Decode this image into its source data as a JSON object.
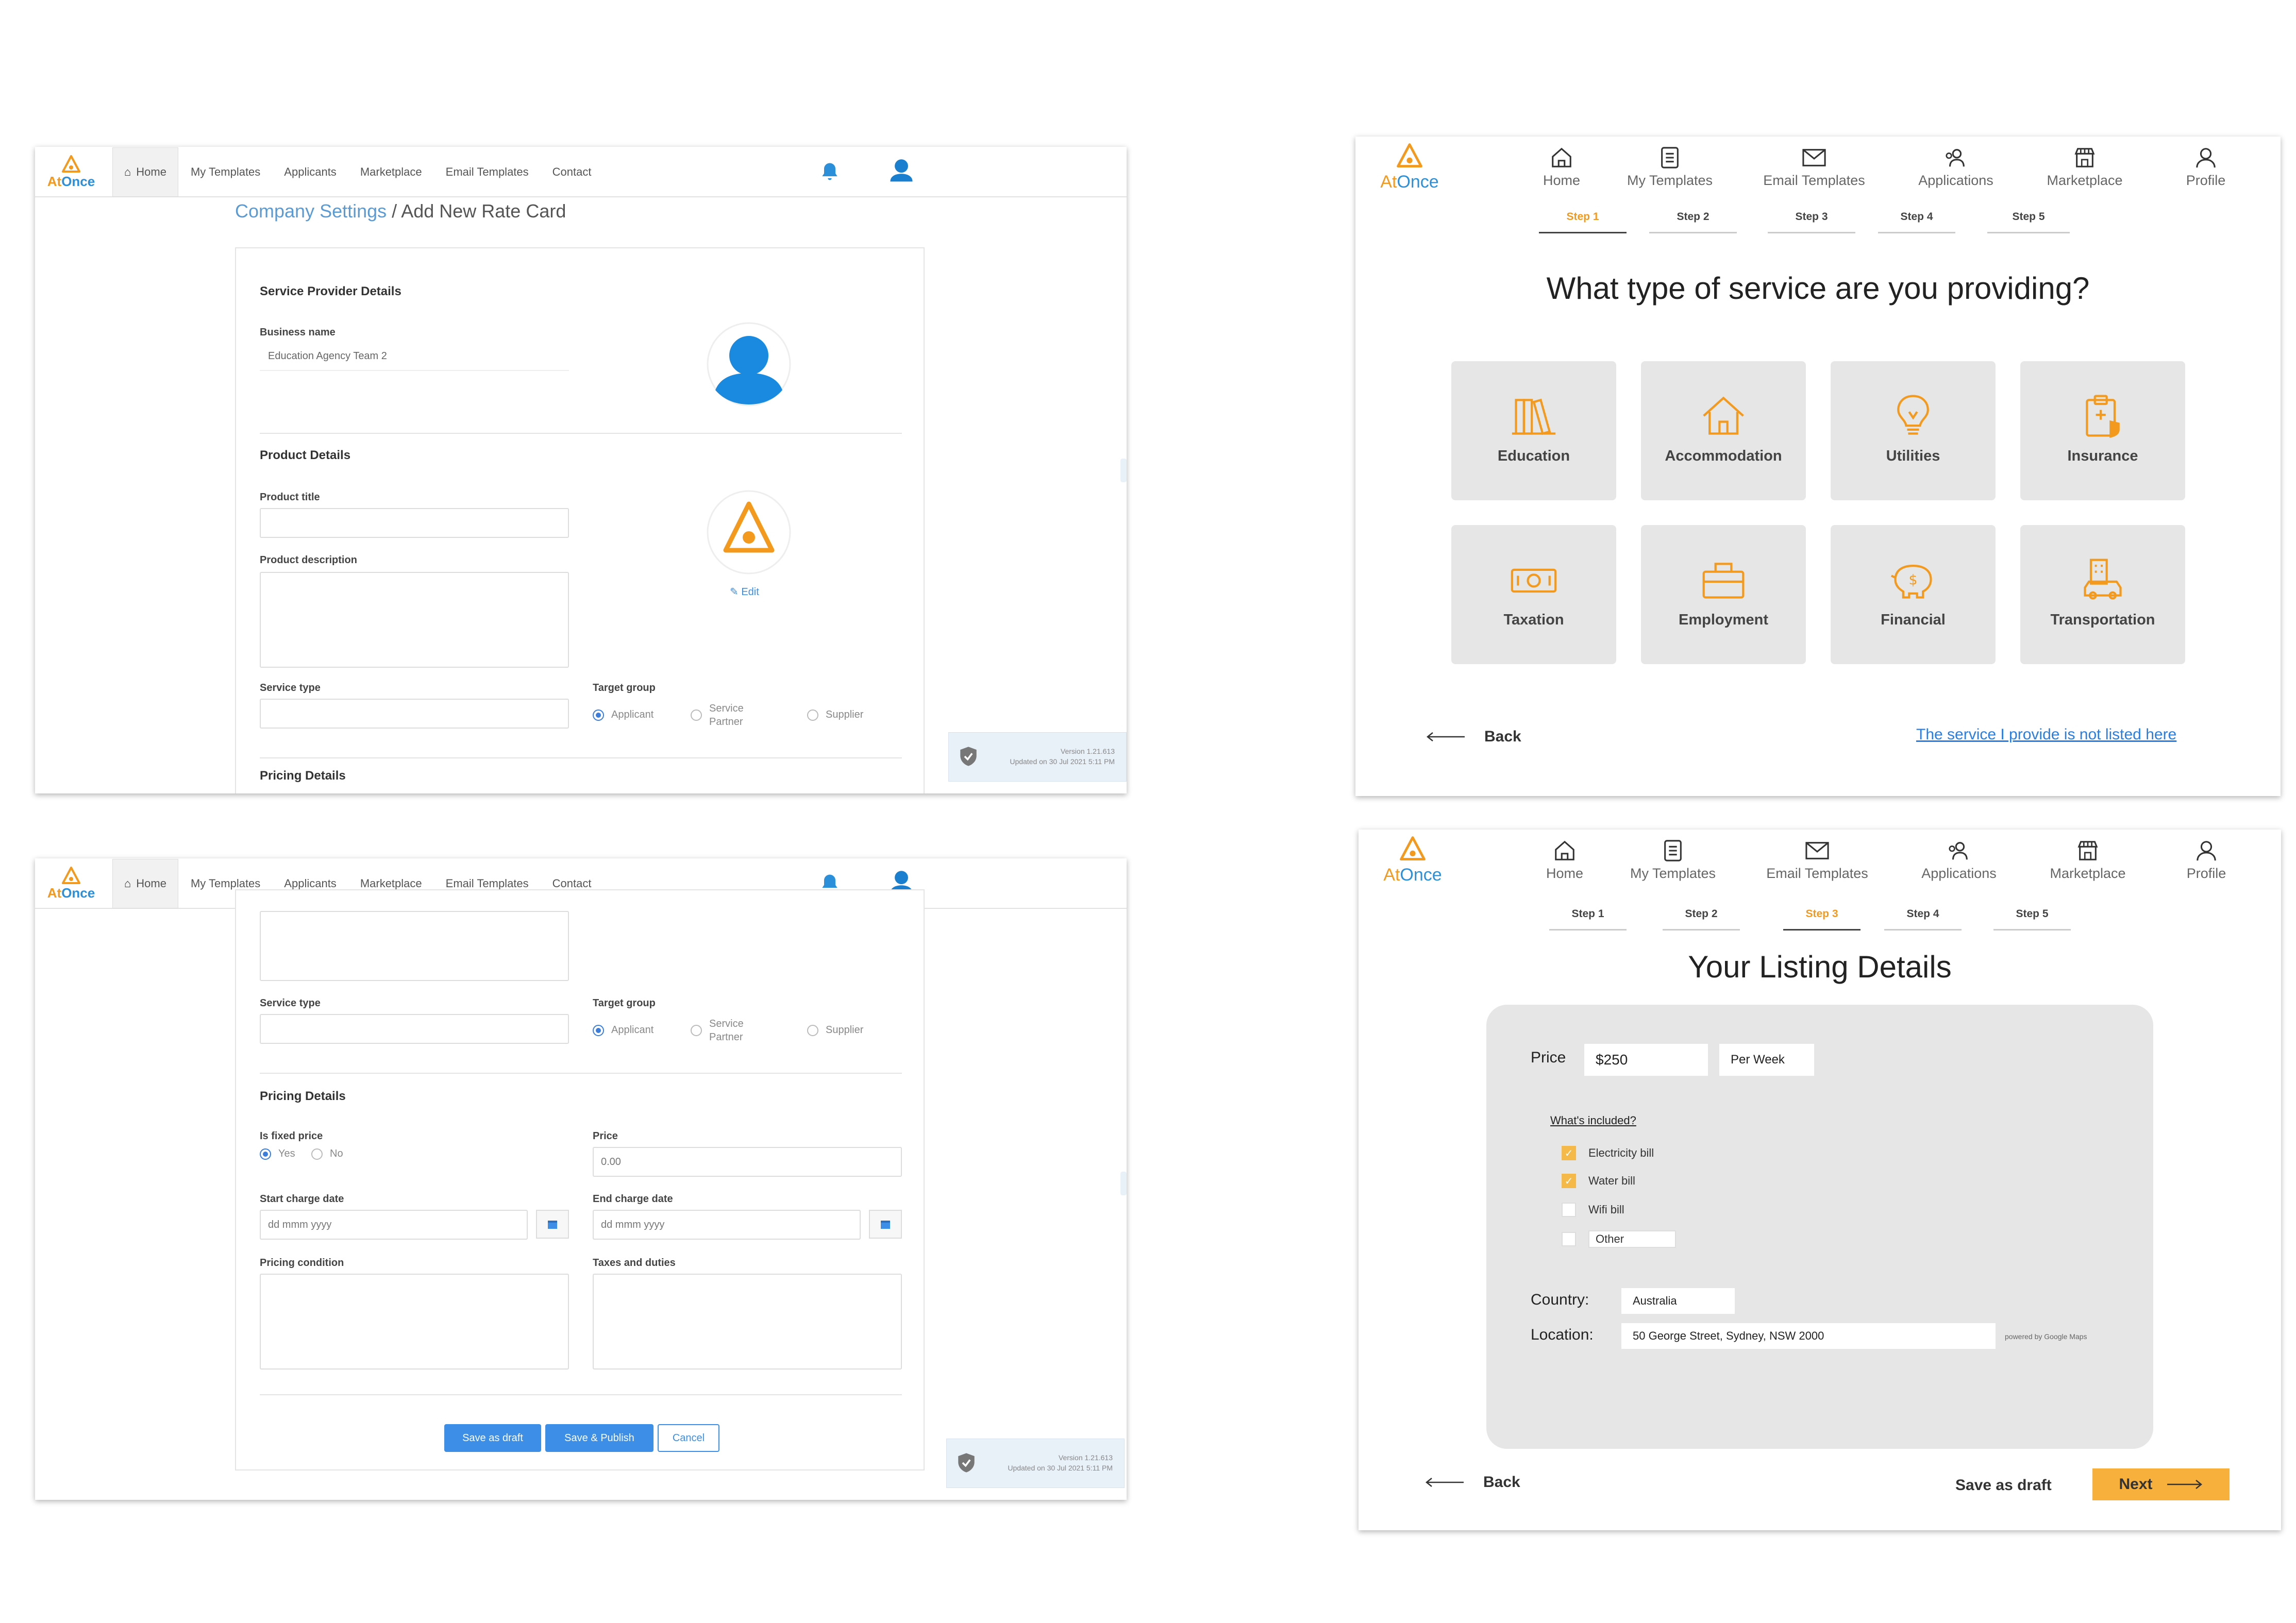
{
  "admin_nav": {
    "logo_prefix": "At",
    "logo_suffix": "Once",
    "items": [
      "Home",
      "My Templates",
      "Applicants",
      "Marketplace",
      "Email Templates",
      "Contact"
    ]
  },
  "screen1": {
    "breadcrumb_parent": "Company Settings",
    "breadcrumb_sep": "/",
    "breadcrumb_current": "Add New Rate Card",
    "service_provider_title": "Service Provider Details",
    "business_name_label": "Business name",
    "business_name_value": "Education Agency Team 2",
    "product_details_title": "Product Details",
    "product_title_label": "Product title",
    "product_description_label": "Product description",
    "edit_label": "Edit",
    "service_type_label": "Service type",
    "target_group_label": "Target group",
    "target_options": [
      "Applicant",
      "Service Partner",
      "Supplier"
    ],
    "pricing_details_title": "Pricing Details",
    "version_line1": "Version 1.21.613",
    "version_line2": "Updated on 30 Jul 2021 5:11 PM"
  },
  "screen2": {
    "service_type_label": "Service type",
    "target_group_label": "Target group",
    "target_options": [
      "Applicant",
      "Service Partner",
      "Supplier"
    ],
    "pricing_details_title": "Pricing Details",
    "is_fixed_price_label": "Is fixed price",
    "fixed_options": [
      "Yes",
      "No"
    ],
    "price_label": "Price",
    "price_value": "0.00",
    "start_date_label": "Start charge date",
    "start_date_placeholder": "dd mmm yyyy",
    "end_date_label": "End charge date",
    "end_date_placeholder": "dd mmm yyyy",
    "pricing_condition_label": "Pricing condition",
    "taxes_label": "Taxes and duties",
    "save_draft": "Save as draft",
    "save_publish": "Save & Publish",
    "cancel": "Cancel",
    "version_line1": "Version 1.21.613",
    "version_line2": "Updated on 30 Jul 2021 5:11 PM"
  },
  "new_nav": {
    "logo_prefix": "At",
    "logo_suffix": "Once",
    "items": [
      "Home",
      "My Templates",
      "Email Templates",
      "Applications",
      "Marketplace",
      "Profile"
    ],
    "icons": [
      "home-icon",
      "templates-icon",
      "email-icon",
      "applications-icon",
      "marketplace-icon",
      "profile-icon"
    ]
  },
  "steps": [
    "Step 1",
    "Step 2",
    "Step 3",
    "Step 4",
    "Step 5"
  ],
  "screen3": {
    "active_step": 0,
    "heading": "What type of service are you providing?",
    "tiles": [
      {
        "label": "Education",
        "icon": "books-icon"
      },
      {
        "label": "Accommodation",
        "icon": "house-icon"
      },
      {
        "label": "Utilities",
        "icon": "lightbulb-icon"
      },
      {
        "label": "Insurance",
        "icon": "clipboard-shield-icon"
      },
      {
        "label": "Taxation",
        "icon": "money-icon"
      },
      {
        "label": "Employment",
        "icon": "briefcase-icon"
      },
      {
        "label": "Financial",
        "icon": "piggy-bank-icon"
      },
      {
        "label": "Transportation",
        "icon": "car-building-icon"
      }
    ],
    "accent": "#f39a1e",
    "back": "Back",
    "not_listed_link": "The service I provide is not listed here"
  },
  "screen4": {
    "active_step": 2,
    "heading": "Your Listing Details",
    "price_label": "Price",
    "price_value": "$250",
    "period_value": "Per Week",
    "whats_included": "What's included?",
    "included": [
      {
        "label": "Electricity bill",
        "checked": true
      },
      {
        "label": "Water bill",
        "checked": true
      },
      {
        "label": "Wifi bill",
        "checked": false
      },
      {
        "label": "Other",
        "checked": false
      }
    ],
    "country_label": "Country:",
    "country_value": "Australia",
    "location_label": "Location:",
    "location_value": "50 George Street, Sydney, NSW 2000",
    "powered_by": "powered by Google Maps",
    "back": "Back",
    "save_draft": "Save as draft",
    "next": "Next",
    "next_color": "#f8b03c"
  }
}
